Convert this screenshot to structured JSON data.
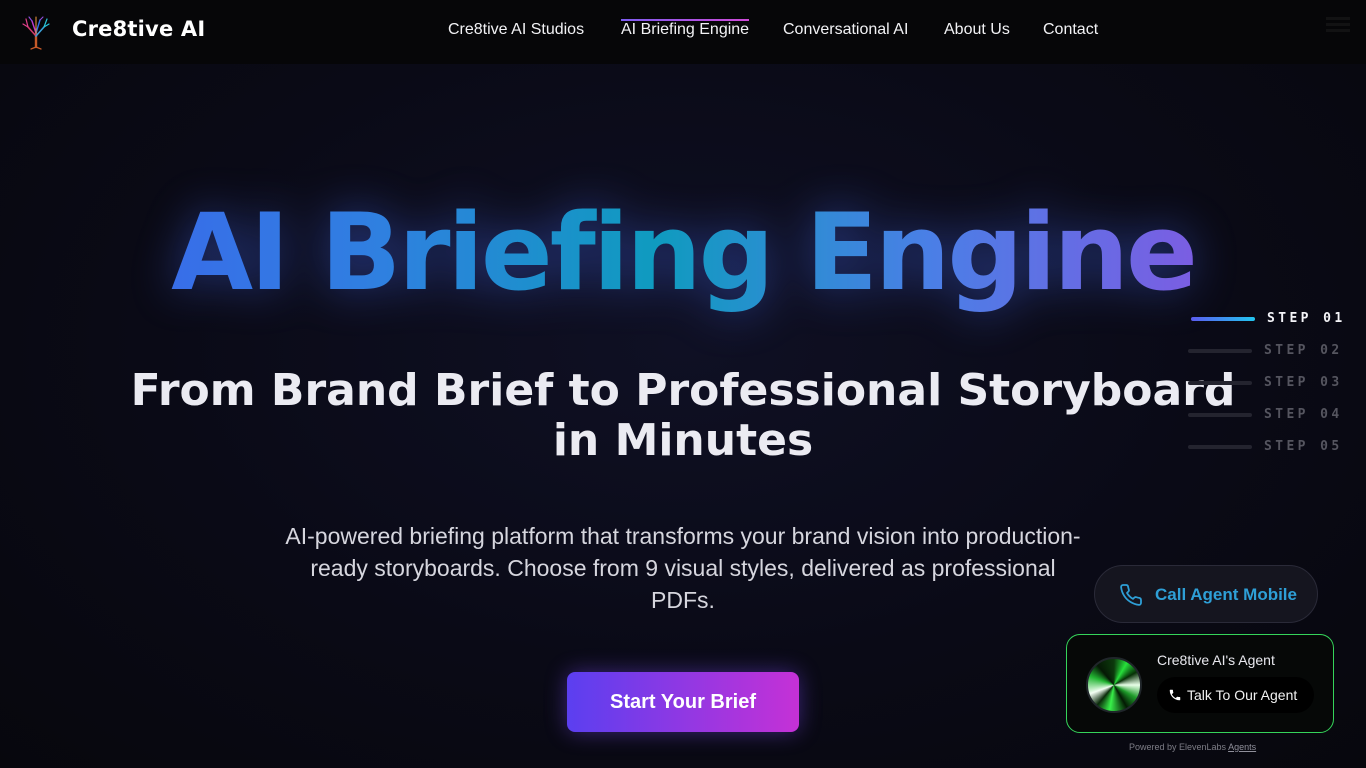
{
  "header": {
    "brand": "Cre8tive AI",
    "logo_icon": "tree-logo-icon",
    "nav": [
      {
        "label": "Cre8tive AI Studios",
        "active": false
      },
      {
        "label": "AI Briefing Engine",
        "active": true
      },
      {
        "label": "Conversational AI",
        "active": false
      },
      {
        "label": "About Us",
        "active": false
      },
      {
        "label": "Contact",
        "active": false
      }
    ]
  },
  "hero": {
    "title": "AI Briefing Engine",
    "subtitle_line1": "From Brand Brief to Professional Storyboard",
    "subtitle_line2": "in Minutes",
    "description": "AI-powered briefing platform that transforms your brand vision into production-ready storyboards. Choose from 9 visual styles, delivered as professional PDFs.",
    "cta_label": "Start Your Brief"
  },
  "steps": [
    {
      "label": "STEP 01",
      "active": true
    },
    {
      "label": "STEP 02",
      "active": false
    },
    {
      "label": "STEP 03",
      "active": false
    },
    {
      "label": "STEP 04",
      "active": false
    },
    {
      "label": "STEP 05",
      "active": false
    }
  ],
  "call_mobile": {
    "label": "Call Agent Mobile",
    "icon": "phone-icon"
  },
  "agent_widget": {
    "name": "Cre8tive AI's Agent",
    "button_label": "Talk To Our Agent",
    "powered_text": "Powered by ElevenLabs",
    "powered_link": "Agents"
  },
  "colors": {
    "background": "#0a0a16",
    "title_gradient_start": "#3f5fef",
    "title_gradient_end": "#9a48e0",
    "cta_gradient_start": "#5b3ff0",
    "cta_gradient_end": "#c531d6",
    "agent_border": "#35d45a",
    "call_text": "#2e9fd6"
  }
}
